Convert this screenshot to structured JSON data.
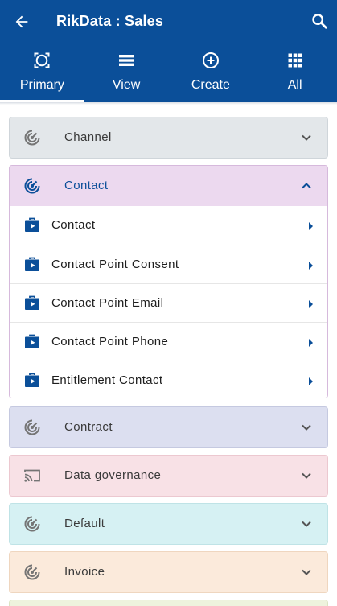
{
  "app": {
    "title": "RikData : Sales"
  },
  "colors": {
    "header": "#0b4f99",
    "accent": "#0b4f99"
  },
  "tabs": [
    {
      "label": "Primary",
      "icon": "focus-frame-icon",
      "active": true
    },
    {
      "label": "View",
      "icon": "list-icon",
      "active": false
    },
    {
      "label": "Create",
      "icon": "add-circle-icon",
      "active": false
    },
    {
      "label": "All",
      "icon": "grid-icon",
      "active": false
    }
  ],
  "sections": [
    {
      "label": "Channel",
      "icon": "radar-icon",
      "expanded": false,
      "color": "#e3e7ea"
    },
    {
      "label": "Contact",
      "icon": "radar-icon",
      "expanded": true,
      "color": "#ecd9ef",
      "items": [
        {
          "label": "Contact",
          "icon": "briefcase-play-icon"
        },
        {
          "label": "Contact Point Consent",
          "icon": "briefcase-play-icon"
        },
        {
          "label": "Contact Point Email",
          "icon": "briefcase-play-icon"
        },
        {
          "label": "Contact Point Phone",
          "icon": "briefcase-play-icon"
        },
        {
          "label": "Entitlement Contact",
          "icon": "briefcase-play-icon"
        }
      ]
    },
    {
      "label": "Contract",
      "icon": "radar-icon",
      "expanded": false,
      "color": "#dcdff0"
    },
    {
      "label": "Data governance",
      "icon": "cast-icon",
      "expanded": false,
      "color": "#f8e1e6"
    },
    {
      "label": "Default",
      "icon": "radar-icon",
      "expanded": false,
      "color": "#d6f1f3"
    },
    {
      "label": "Invoice",
      "icon": "radar-icon",
      "expanded": false,
      "color": "#fbeadb"
    }
  ]
}
